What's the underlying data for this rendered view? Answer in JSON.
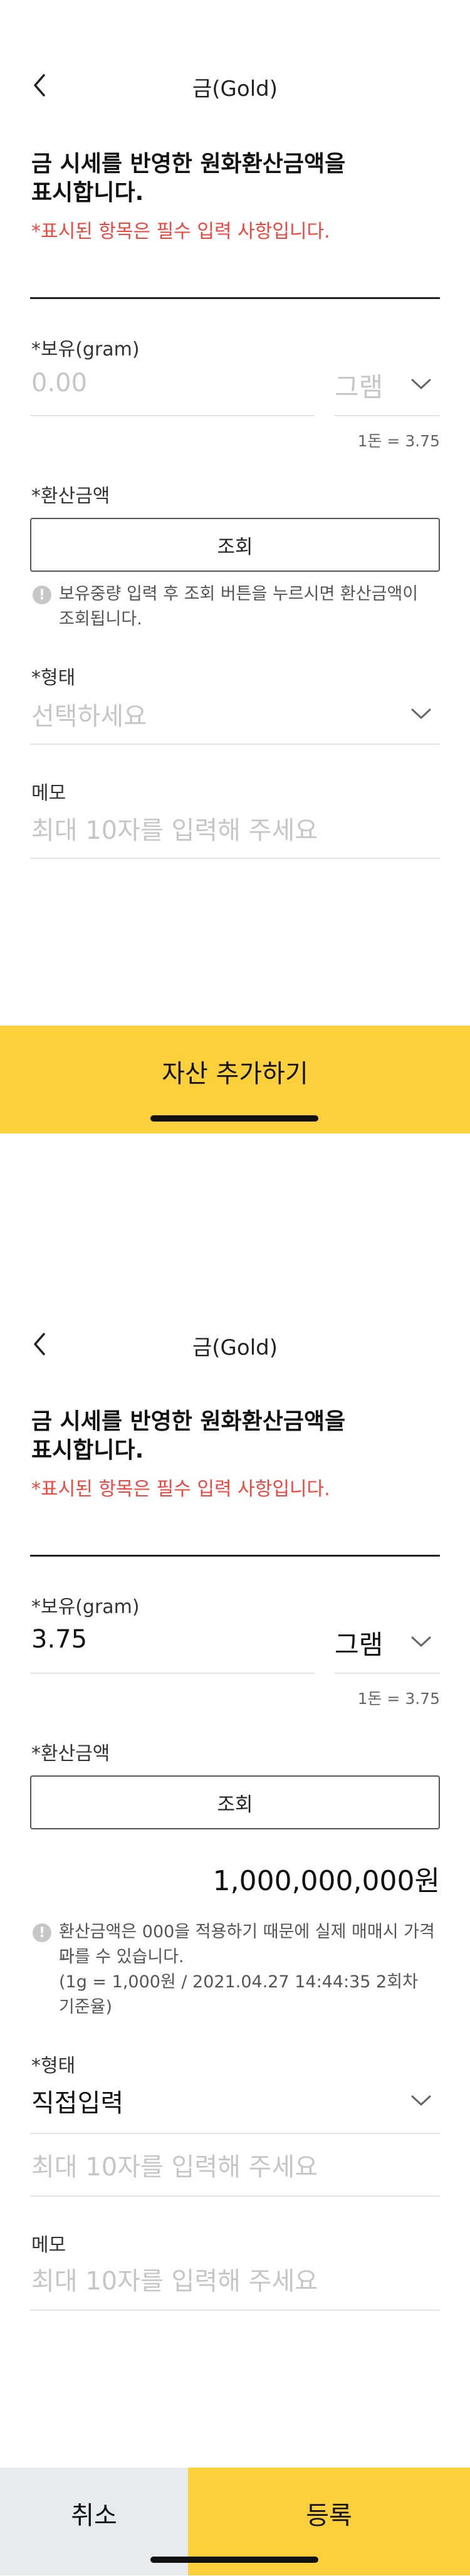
{
  "screen1": {
    "header": {
      "title": "금(Gold)"
    },
    "intro": {
      "line1": "금 시세를 반영한 원화환산금액을",
      "line2": "표시합니다.",
      "required_note": "*표시된 항목은 필수 입력 사항입니다."
    },
    "holding": {
      "label": "*보유(gram)",
      "placeholder": "0.00",
      "unit": "그램",
      "conversion_note": "1돈 = 3.75"
    },
    "converted": {
      "label": "*환산금액",
      "lookup_button": "조회",
      "info_line1": "보유중량 입력 후 조회 버튼을 누르시면 환산금액이",
      "info_line2": "조회됩니다."
    },
    "form_type": {
      "label": "*형태",
      "placeholder": "선택하세요"
    },
    "memo": {
      "label": "메모",
      "placeholder": "최대 10자를 입력해 주세요"
    },
    "cta": {
      "label": "자산 추가하기"
    }
  },
  "screen2": {
    "header": {
      "title": "금(Gold)"
    },
    "intro": {
      "line1": "금 시세를 반영한 원화환산금액을",
      "line2": "표시합니다.",
      "required_note": "*표시된 항목은 필수 입력 사항입니다."
    },
    "holding": {
      "label": "*보유(gram)",
      "value": "3.75",
      "unit": "그램",
      "conversion_note": "1돈 = 3.75"
    },
    "converted": {
      "label": "*환산금액",
      "lookup_button": "조회",
      "amount": "1,000,000,000원",
      "info_line1": "환산금액은 000을 적용하기 때문에 실제 매매시 가격과",
      "info_line2": "다를 수 있습니다.",
      "info_line3": "(1g = 1,000원 / 2021.04.27 14:44:35 2회차",
      "info_line4": "기준율)"
    },
    "form_type": {
      "label": "*형태",
      "value": "직접입력",
      "direct_placeholder": "최대 10자를 입력해 주세요"
    },
    "memo": {
      "label": "메모",
      "placeholder": "최대 10자를 입력해 주세요"
    },
    "buttons": {
      "cancel": "취소",
      "register": "등록"
    }
  },
  "icons": {
    "back": "back-chevron-icon",
    "dropdown": "chevron-down-icon",
    "info": "info-icon"
  },
  "colors": {
    "accent": "#fcd03a",
    "required": "#f2453d",
    "cancel_bg": "#e8ebee",
    "placeholder": "#c6c6c6"
  }
}
